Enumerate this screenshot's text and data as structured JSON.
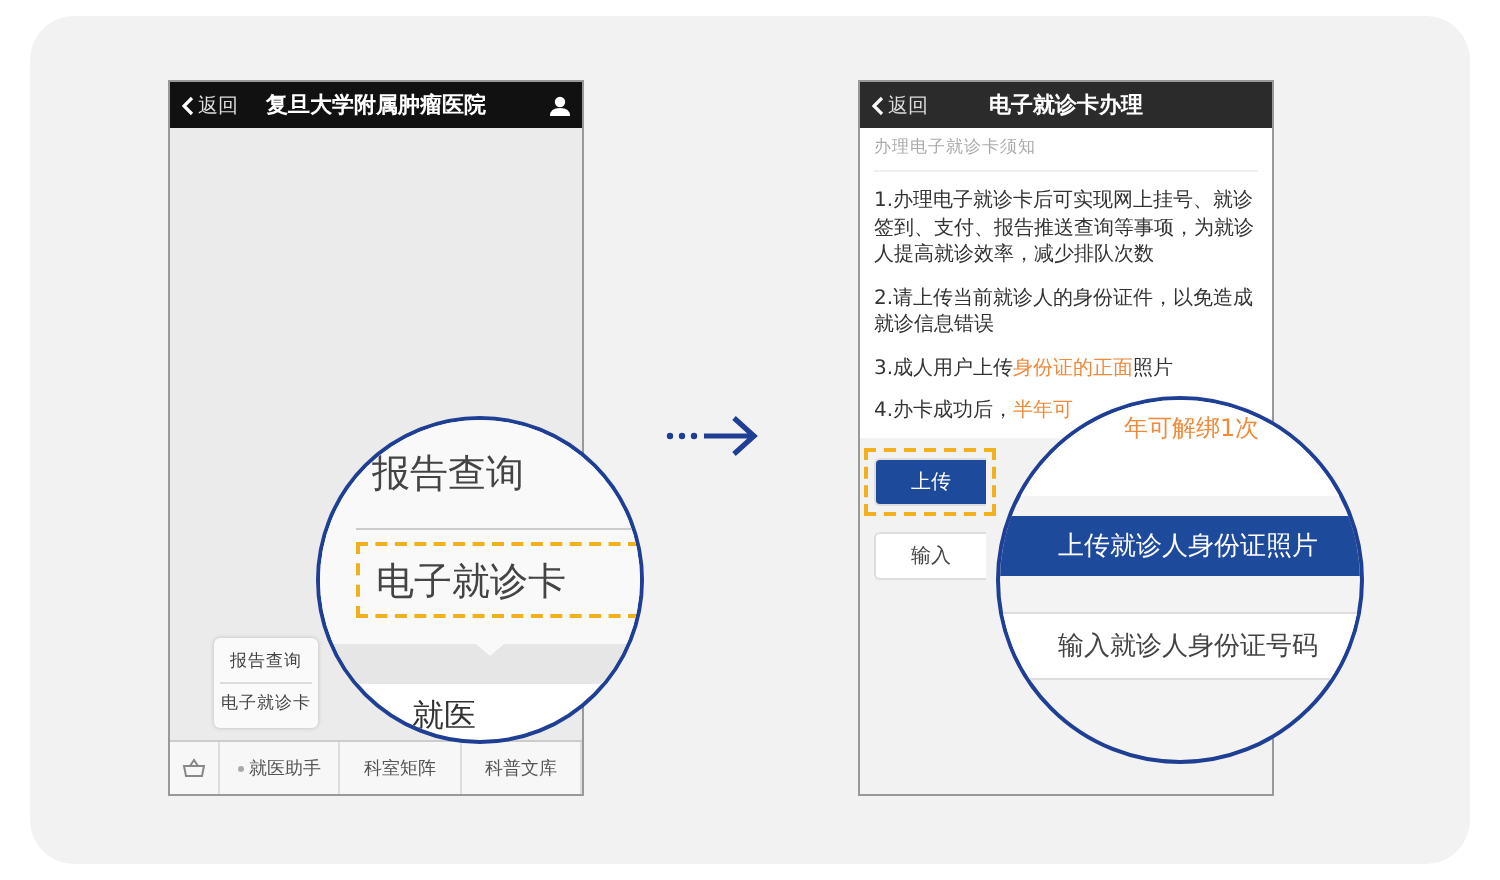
{
  "left_phone": {
    "header": {
      "back": "返回",
      "title": "复旦大学附属肿瘤医院"
    },
    "popup_menu": [
      "报告查询",
      "电子就诊卡"
    ],
    "tab_bar": [
      "就医助手",
      "科室矩阵",
      "科普文库"
    ],
    "magnifier": {
      "items": [
        {
          "label": "报告查询",
          "highlighted": false
        },
        {
          "label": "电子就诊卡",
          "highlighted": true
        }
      ],
      "tab_fragment": "就医"
    }
  },
  "right_phone": {
    "header": {
      "back": "返回",
      "title": "电子就诊卡办理"
    },
    "notice_title": "办理电子就诊卡须知",
    "notices": [
      [
        {
          "text": "1.办理电子就诊卡后可实现网上挂号、就诊签到、支付、报告推送查询等事项，为就诊人提高就诊效率，减少排队次数",
          "highlight": false
        }
      ],
      [
        {
          "text": "2.请上传当前就诊人的身份证件，以免造成就诊信息错误",
          "highlight": false
        }
      ],
      [
        {
          "text": "3.成人用户上传",
          "highlight": false
        },
        {
          "text": "身份证的正面",
          "highlight": true
        },
        {
          "text": "照片",
          "highlight": false
        }
      ],
      [
        {
          "text": "4.办卡成功后，",
          "highlight": false
        },
        {
          "text": "半年可",
          "highlight": true
        }
      ]
    ],
    "buttons": [
      {
        "label": "上传",
        "kind": "primary",
        "highlighted": true
      },
      {
        "label": "输入",
        "kind": "secondary",
        "highlighted": false
      }
    ],
    "magnifier": {
      "caption": "年可解绑1次",
      "buttons": [
        {
          "label": "上传就诊人身份证照片",
          "kind": "primary"
        },
        {
          "label": "输入就诊人身份证号码",
          "kind": "secondary"
        }
      ]
    }
  }
}
